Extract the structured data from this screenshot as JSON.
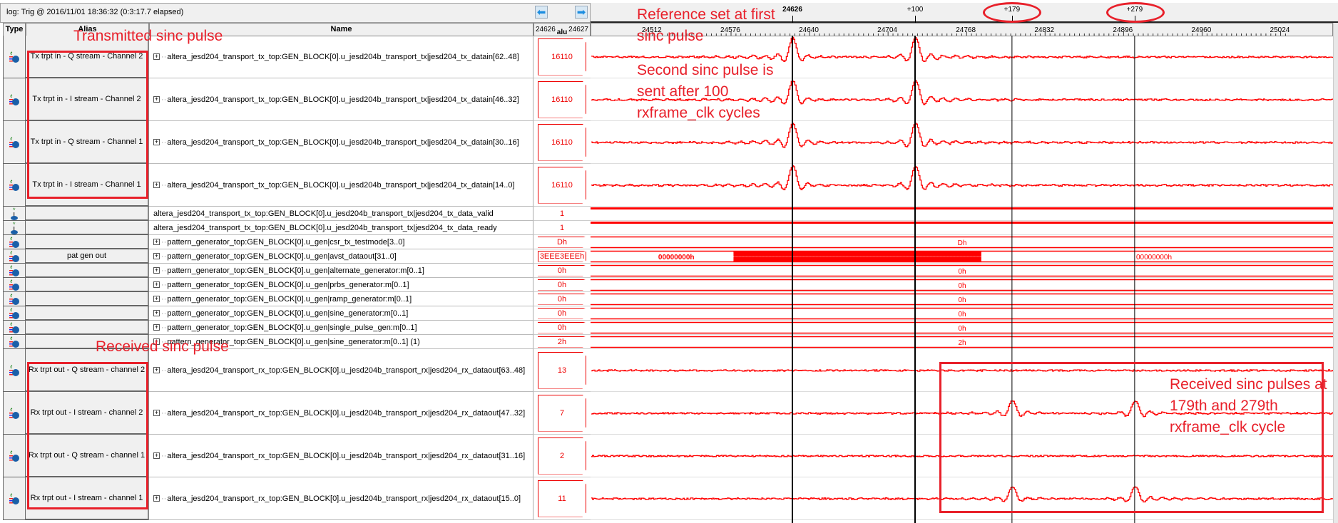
{
  "log_title": "log: Trig @ 2016/11/01 18:36:32 (0:3:17.7 elapsed)",
  "nav": {
    "prev_icon": "arrow-left-icon",
    "next_icon": "arrow-right-icon"
  },
  "columns": {
    "type": "Type",
    "alias": "Alias",
    "name": "Name",
    "value_left": "24626",
    "value_mid": "alu",
    "value_right": "24627"
  },
  "reference_cycle": 24626,
  "cursors": [
    {
      "label": "24626",
      "cycle": 24626,
      "bold": true
    },
    {
      "label": "+100",
      "cycle": 24726,
      "bold": false
    },
    {
      "label": "+179",
      "cycle": 24805,
      "bold": false
    },
    {
      "label": "+279",
      "cycle": 24905,
      "bold": false
    }
  ],
  "ruler_labels": [
    "24512",
    "24576",
    "24640",
    "24704",
    "24768",
    "24832",
    "24896",
    "24960",
    "25024"
  ],
  "rows": [
    {
      "icon": "bus-icon",
      "alias": "Tx trpt in - Q stream - Channel 2",
      "name": "altera_jesd204_transport_tx_top:GEN_BLOCK[0].u_jesd204b_transport_tx|jesd204_tx_datain[62..48]",
      "expand": true,
      "value": "16110",
      "tall": true,
      "wave": "analog",
      "pulses": [
        24626,
        24726
      ],
      "amp": 1.0
    },
    {
      "icon": "bus-icon",
      "alias": "Tx trpt in - I stream - Channel 2",
      "name": "altera_jesd204_transport_tx_top:GEN_BLOCK[0].u_jesd204b_transport_tx|jesd204_tx_datain[46..32]",
      "expand": true,
      "value": "16110",
      "tall": true,
      "wave": "analog",
      "pulses": [
        24626,
        24726
      ],
      "amp": 1.0
    },
    {
      "icon": "bus-icon",
      "alias": "Tx trpt in - Q stream - Channel 1",
      "name": "altera_jesd204_transport_tx_top:GEN_BLOCK[0].u_jesd204b_transport_tx|jesd204_tx_datain[30..16]",
      "expand": true,
      "value": "16110",
      "tall": true,
      "wave": "analog",
      "pulses": [
        24626,
        24726
      ],
      "amp": 1.0
    },
    {
      "icon": "bus-icon",
      "alias": "Tx trpt in - I stream - Channel 1",
      "name": "altera_jesd204_transport_tx_top:GEN_BLOCK[0].u_jesd204b_transport_tx|jesd204_tx_datain[14..0]",
      "expand": true,
      "value": "16110",
      "tall": true,
      "wave": "analog",
      "pulses": [
        24626,
        24726
      ],
      "amp": 1.0
    },
    {
      "icon": "signal-icon",
      "alias": "",
      "name": "altera_jesd204_transport_tx_top:GEN_BLOCK[0].u_jesd204b_transport_tx|jesd204_tx_data_valid",
      "expand": false,
      "value": "1",
      "tall": false,
      "wave": "high"
    },
    {
      "icon": "signal-icon",
      "alias": "",
      "name": "altera_jesd204_transport_tx_top:GEN_BLOCK[0].u_jesd204b_transport_tx|jesd204_tx_data_ready",
      "expand": false,
      "value": "1",
      "tall": false,
      "wave": "high"
    },
    {
      "icon": "bus-icon",
      "alias": "",
      "name": "pattern_generator_top:GEN_BLOCK[0].u_gen|csr_tx_testmode[3..0]",
      "expand": true,
      "value": "Dh",
      "tall": false,
      "wave": "bus",
      "bus_label": "Dh"
    },
    {
      "icon": "bus-icon",
      "alias": "pat gen out",
      "name": "pattern_generator_top:GEN_BLOCK[0].u_gen|avst_dataout[31..0]",
      "expand": true,
      "value": "3EEE3EEEh",
      "tall": false,
      "wave": "busburst",
      "bus_labels": [
        "00000000h",
        "00000000h"
      ],
      "burst": [
        24578,
        24780
      ]
    },
    {
      "icon": "bus-icon",
      "alias": "",
      "name": "pattern_generator_top:GEN_BLOCK[0].u_gen|alternate_generator:m[0..1]",
      "expand": true,
      "value": "0h",
      "tall": false,
      "wave": "bus",
      "bus_label": "0h"
    },
    {
      "icon": "bus-icon",
      "alias": "",
      "name": "pattern_generator_top:GEN_BLOCK[0].u_gen|prbs_generator:m[0..1]",
      "expand": true,
      "value": "0h",
      "tall": false,
      "wave": "bus",
      "bus_label": "0h"
    },
    {
      "icon": "bus-icon",
      "alias": "",
      "name": "pattern_generator_top:GEN_BLOCK[0].u_gen|ramp_generator:m[0..1]",
      "expand": true,
      "value": "0h",
      "tall": false,
      "wave": "bus",
      "bus_label": "0h"
    },
    {
      "icon": "bus-icon",
      "alias": "",
      "name": "pattern_generator_top:GEN_BLOCK[0].u_gen|sine_generator:m[0..1]",
      "expand": true,
      "value": "0h",
      "tall": false,
      "wave": "bus",
      "bus_label": "0h"
    },
    {
      "icon": "bus-icon",
      "alias": "",
      "name": "pattern_generator_top:GEN_BLOCK[0].u_gen|single_pulse_gen:m[0..1]",
      "expand": true,
      "value": "0h",
      "tall": false,
      "wave": "bus",
      "bus_label": "0h"
    },
    {
      "icon": "bus-icon",
      "alias": "",
      "name": "pattern_generator_top:GEN_BLOCK[0].u_gen|sine_generator:m[0..1] (1)",
      "expand": true,
      "value": "2h",
      "tall": false,
      "wave": "bus",
      "bus_label": "2h"
    },
    {
      "icon": "bus-icon",
      "alias": "Rx trpt out - Q stream - channel 2",
      "name": "altera_jesd204_transport_rx_top:GEN_BLOCK[0].u_jesd204b_transport_rx|jesd204_rx_dataout[63..48]",
      "expand": true,
      "value": "13",
      "tall": true,
      "wave": "analog",
      "pulses": [],
      "amp": 0
    },
    {
      "icon": "bus-icon",
      "alias": "Rx trpt out - I stream - channel 2",
      "name": "altera_jesd204_transport_rx_top:GEN_BLOCK[0].u_jesd204b_transport_rx|jesd204_rx_dataout[47..32]",
      "expand": true,
      "value": "7",
      "tall": true,
      "wave": "analog",
      "pulses": [
        24805,
        24905
      ],
      "amp": 0.65
    },
    {
      "icon": "bus-icon",
      "alias": "Rx trpt out - Q stream - channel 1",
      "name": "altera_jesd204_transport_rx_top:GEN_BLOCK[0].u_jesd204b_transport_rx|jesd204_rx_dataout[31..16]",
      "expand": true,
      "value": "2",
      "tall": true,
      "wave": "analog",
      "pulses": [],
      "amp": 0
    },
    {
      "icon": "bus-icon",
      "alias": "Rx trpt out - I stream - channel 1",
      "name": "altera_jesd204_transport_rx_top:GEN_BLOCK[0].u_jesd204b_transport_rx|jesd204_rx_dataout[15..0]",
      "expand": true,
      "value": "11",
      "tall": true,
      "wave": "analog",
      "pulses": [
        24805,
        24905
      ],
      "amp": 0.65
    }
  ],
  "annotations": {
    "tx_label": "Transmitted sinc pulse",
    "rx_label": "Received sinc pulse",
    "reference": [
      "Reference set at first",
      "sinc pulse"
    ],
    "second": [
      "Second sinc pulse is",
      "sent after 100",
      "rxframe_clk cycles"
    ],
    "received": [
      "Received sinc pulses at",
      "179th and 279th",
      "rxframe_clk cycle"
    ],
    "color": "#e8202a"
  },
  "wave_color": "#ff0000"
}
